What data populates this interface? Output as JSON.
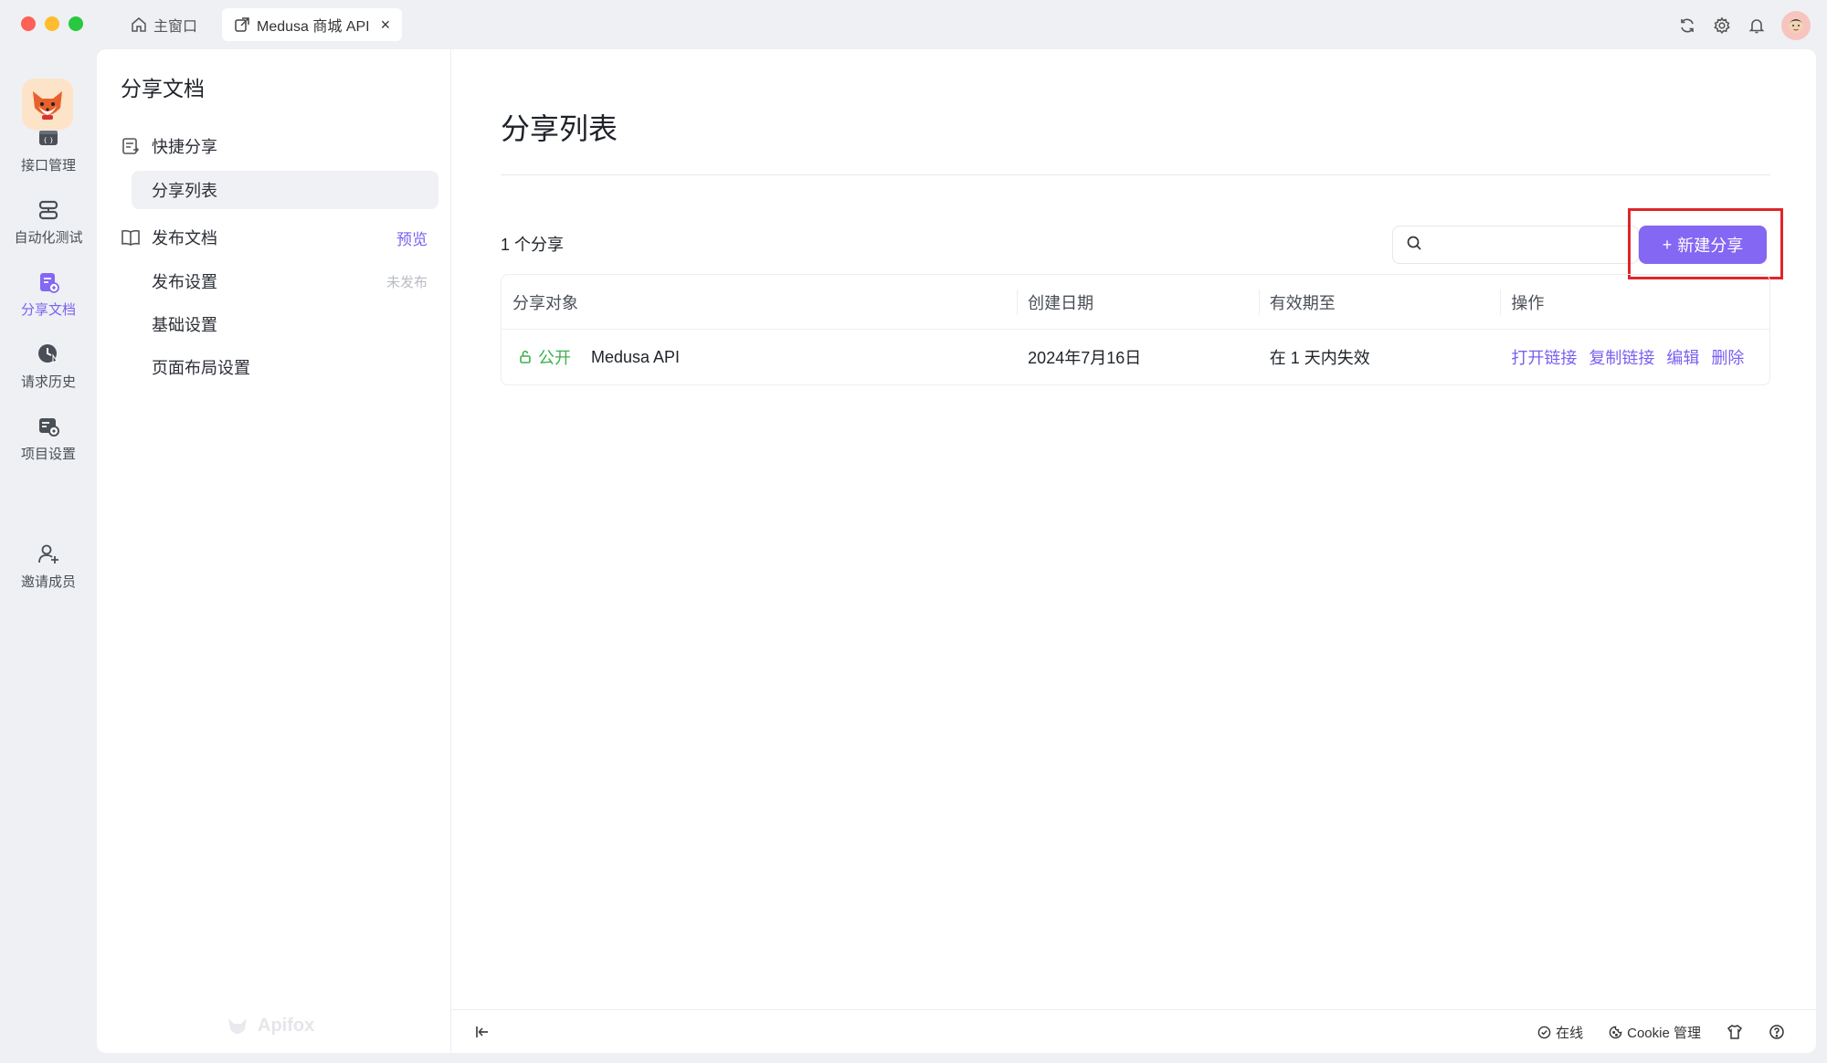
{
  "tabs": {
    "home": "主窗口",
    "active": "Medusa 商城 API",
    "close": "×"
  },
  "rail": {
    "items": [
      {
        "label": "接口管理",
        "icon": "api-icon"
      },
      {
        "label": "自动化测试",
        "icon": "automation-icon"
      },
      {
        "label": "分享文档",
        "icon": "share-doc-icon"
      },
      {
        "label": "请求历史",
        "icon": "history-icon"
      },
      {
        "label": "项目设置",
        "icon": "project-settings-icon"
      },
      {
        "label": "邀请成员",
        "icon": "invite-member-icon"
      }
    ]
  },
  "sidebar": {
    "title": "分享文档",
    "quick_share": "快捷分享",
    "share_list": "分享列表",
    "publish_docs": "发布文档",
    "preview": "预览",
    "publish_settings": "发布设置",
    "unpublished": "未发布",
    "basic_settings": "基础设置",
    "layout_settings": "页面布局设置",
    "watermark": "Apifox"
  },
  "main": {
    "title": "分享列表",
    "count": "1 个分享",
    "search_placeholder": "",
    "new_button": "新建分享",
    "new_button_plus": "+"
  },
  "table": {
    "headers": [
      "分享对象",
      "创建日期",
      "有效期至",
      "操作"
    ],
    "rows": [
      {
        "visibility": "公开",
        "name": "Medusa API",
        "created": "2024年7月16日",
        "expires": "在 1 天内失效",
        "actions": [
          "打开链接",
          "复制链接",
          "编辑",
          "删除"
        ]
      }
    ]
  },
  "footer": {
    "online": "在线",
    "cookie": "Cookie 管理"
  },
  "colors": {
    "accent": "#8467f2",
    "public_green": "#3ab14f",
    "highlight_red": "#e0252b"
  }
}
